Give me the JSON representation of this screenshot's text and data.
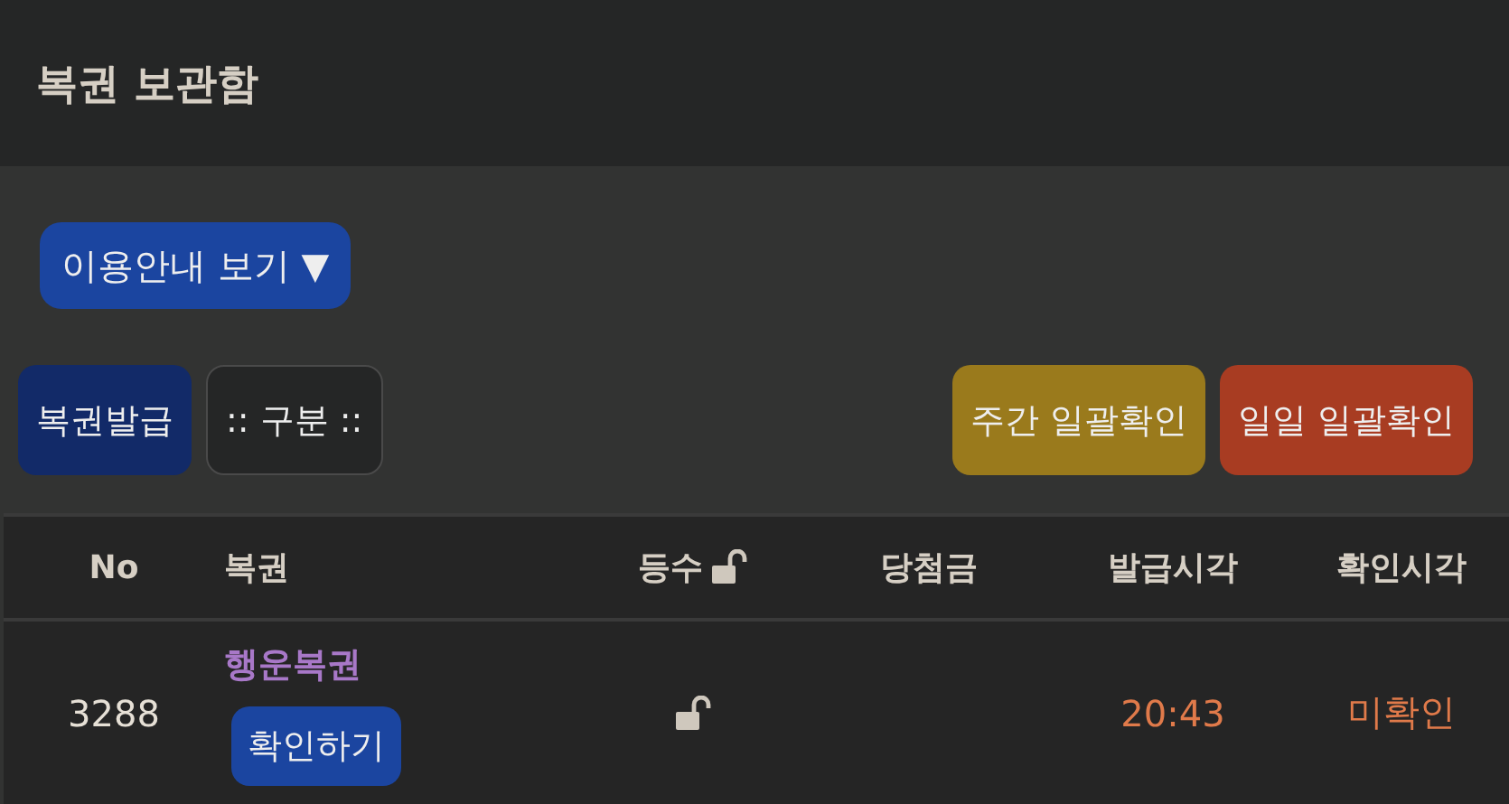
{
  "header": {
    "title": "복권 보관함"
  },
  "guide_button": {
    "label": "이용안내 보기 ▼"
  },
  "left_buttons": [
    {
      "label": "복권발급",
      "kind": "primary"
    },
    {
      "label": ":: 구분 ::",
      "kind": "filter"
    }
  ],
  "right_buttons": [
    {
      "label": "주간 일괄확인",
      "color": "#9a7a1c"
    },
    {
      "label": "일일 일괄확인",
      "color": "#a83c22"
    }
  ],
  "table": {
    "columns": [
      {
        "label": "No",
        "kind": "plain"
      },
      {
        "label": "복권",
        "kind": "plain"
      },
      {
        "label": "등수",
        "kind": "lock",
        "locked": false
      },
      {
        "label": "당첨금",
        "kind": "plain"
      },
      {
        "label": "발급시각",
        "kind": "plain"
      },
      {
        "label": "확인시각",
        "kind": "plain"
      }
    ],
    "rows": [
      {
        "no": "3288",
        "name": "행운복권",
        "check_button": "확인하기",
        "locked": false,
        "issued": "20:43",
        "checked_at": "미확인"
      }
    ]
  }
}
